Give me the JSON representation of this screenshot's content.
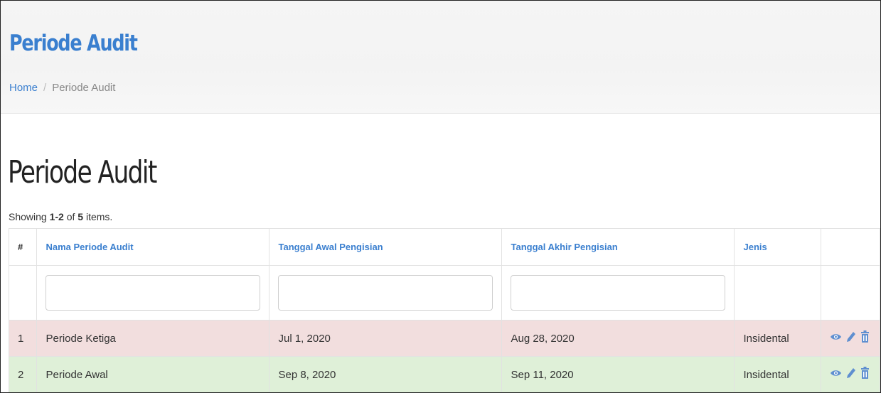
{
  "header": {
    "title": "Periode Audit",
    "breadcrumb": {
      "home": "Home",
      "separator": "/",
      "current": "Periode Audit"
    }
  },
  "content": {
    "title": "Periode Audit",
    "summary": {
      "prefix": "Showing",
      "range": "1-2",
      "of": "of",
      "total": "5",
      "suffix": "items."
    }
  },
  "table": {
    "columns": [
      "#",
      "Nama Periode Audit",
      "Tanggal Awal Pengisian",
      "Tanggal Akhir Pengisian",
      "Jenis",
      ""
    ],
    "filters": [
      {
        "value": "",
        "placeholder": ""
      },
      {
        "value": "",
        "placeholder": ""
      },
      {
        "value": "",
        "placeholder": ""
      }
    ],
    "rows": [
      {
        "num": "1",
        "nama": "Periode Ketiga",
        "awal": "Jul 1, 2020",
        "akhir": "Aug 28, 2020",
        "jenis": "Insidental",
        "status": "danger"
      },
      {
        "num": "2",
        "nama": "Periode Awal",
        "awal": "Sep 8, 2020",
        "akhir": "Sep 11, 2020",
        "jenis": "Insidental",
        "status": "success"
      }
    ],
    "action_icons": [
      "eye-icon",
      "pencil-icon",
      "trash-icon"
    ]
  },
  "colors": {
    "link": "#3a7fcf",
    "row_danger": "#f2dede",
    "row_success": "#dff0d8",
    "header_bg": "#f5f5f5"
  }
}
